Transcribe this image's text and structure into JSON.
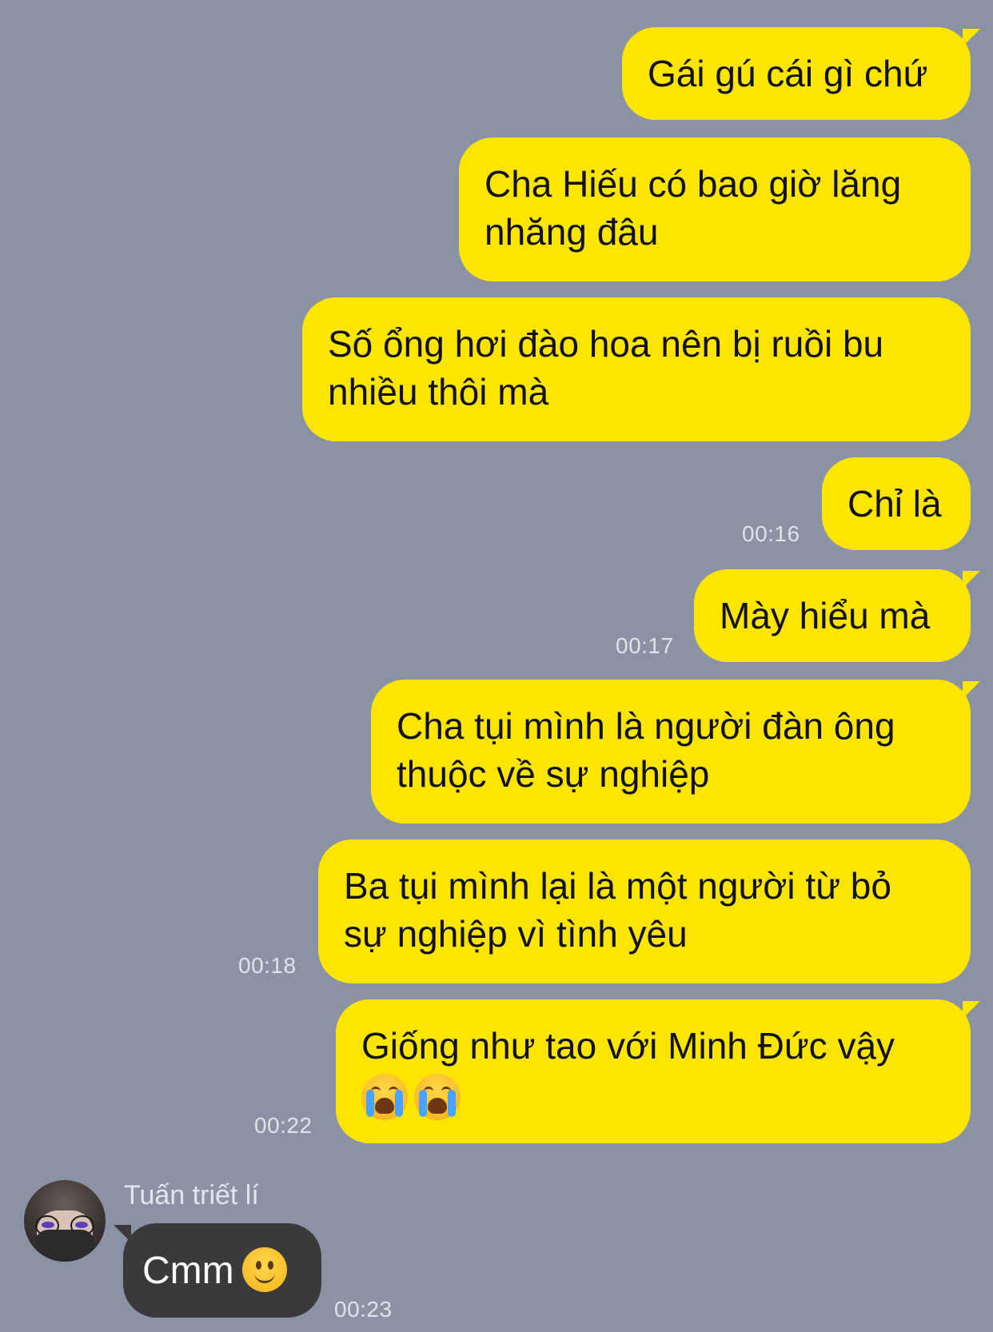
{
  "messages_sent": [
    {
      "text": "Gái gú cái gì chứ",
      "time": ""
    },
    {
      "text": "Cha Hiếu có bao giờ lăng\nnhăng đâu",
      "time": ""
    },
    {
      "text": "Số ổng hơi đào hoa nên bị ruồi bu\nnhiều thôi mà",
      "time": ""
    },
    {
      "text": "Chỉ là",
      "time": "00:16"
    },
    {
      "text": "Mày hiểu mà",
      "time": "00:17"
    },
    {
      "text": "Cha tụi mình là người đàn ông\nthuộc về sự nghiệp",
      "time": ""
    },
    {
      "text": "Ba tụi mình lại là một người từ bỏ\nsự nghiệp vì tình yêu",
      "time": "00:18"
    },
    {
      "text": "Giống như tao với Minh Đức vậy",
      "time": "00:22",
      "emoji": "loudly-crying-face x2"
    }
  ],
  "incoming": {
    "sender_name": "Tuấn triết lí",
    "text": "Cmm",
    "emoji": "slightly-smiling-face",
    "time": "00:23",
    "avatar": "avatar-photo"
  },
  "colors": {
    "background": "#8a93a3",
    "sent_bubble": "#fee500",
    "received_bubble": "#3a3a3c"
  }
}
